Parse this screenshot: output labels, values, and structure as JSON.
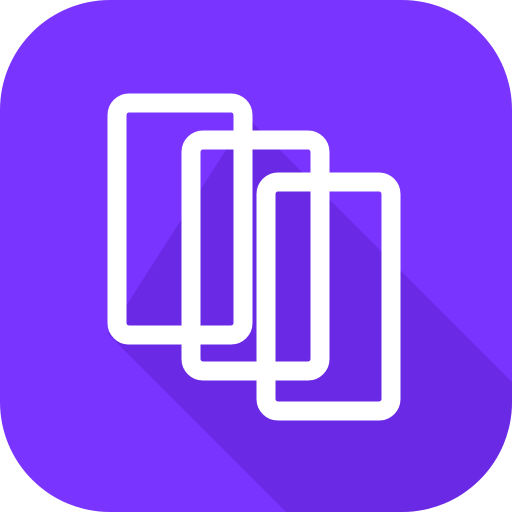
{
  "icon": {
    "name": "stacked-cards-app-icon",
    "background_color": "#7a34ff",
    "foreground_color": "#ffffff",
    "shadow_color": "#4c17b4",
    "card_count": 3
  }
}
